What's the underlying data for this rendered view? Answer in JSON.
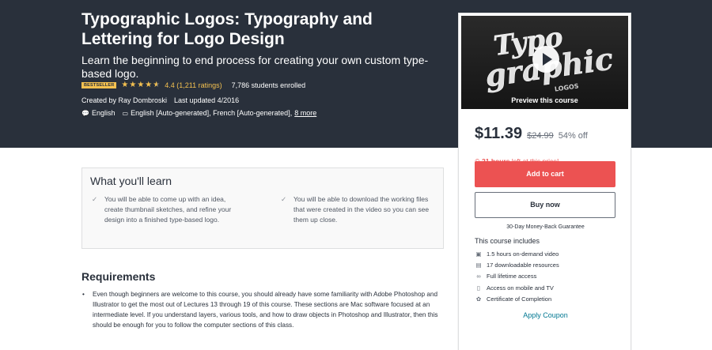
{
  "hero": {
    "title": "Typographic Logos: Typography and Lettering for Logo Design",
    "subtitle": "Learn the beginning to end process for creating your own custom type-based logo.",
    "badge": "BESTSELLER",
    "rating_stars": 4.4,
    "rating": "4.4 (1,211 ratings)",
    "students": "7,786 students enrolled",
    "created_by": "Created by Ray Dombroski",
    "last_updated": "Last updated 4/2016",
    "language": "English",
    "captions": "English [Auto-generated], French [Auto-generated],",
    "more_link": "8 more"
  },
  "card": {
    "preview_logo_text": [
      "Typo",
      "graphic",
      "LOGOS"
    ],
    "preview_label": "Preview this course",
    "price": "$11.39",
    "original_price": "$24.99",
    "discount": "54% off",
    "timer_strong": "21 hours",
    "timer_rest": " left at this price!",
    "add_to_cart": "Add to cart",
    "buy_now": "Buy now",
    "guarantee": "30-Day Money-Back Guarantee",
    "includes_title": "This course includes",
    "includes": [
      {
        "icon": "video-icon",
        "label": "1.5 hours on-demand video"
      },
      {
        "icon": "file-icon",
        "label": "17 downloadable resources"
      },
      {
        "icon": "infinity-icon",
        "label": "Full lifetime access"
      },
      {
        "icon": "mobile-icon",
        "label": "Access on mobile and TV"
      },
      {
        "icon": "certificate-icon",
        "label": "Certificate of Completion"
      }
    ],
    "apply_coupon": "Apply Coupon"
  },
  "learn": {
    "title": "What you'll learn",
    "items": [
      "You will be able to come up with an idea, create thumbnail sketches, and refine your design into a finished type-based logo.",
      "You will be able to download the working files that were created in the video so you can see them up close."
    ]
  },
  "requirements": {
    "title": "Requirements",
    "items": [
      "Even though beginners are welcome to this course, you should already have some familiarity with Adobe Photoshop and Illustrator to get the most out of Lectures 13 through 19 of this course. These sections are Mac software focused at an intermediate level. If you understand layers, various tools, and how to draw objects in Photoshop and Illustrator, then this should be enough for you to follow the computer sections of this class."
    ]
  },
  "colors": {
    "hero_bg": "#29303b",
    "accent_red": "#ec5252",
    "star": "#f4c150",
    "link": "#007791"
  }
}
